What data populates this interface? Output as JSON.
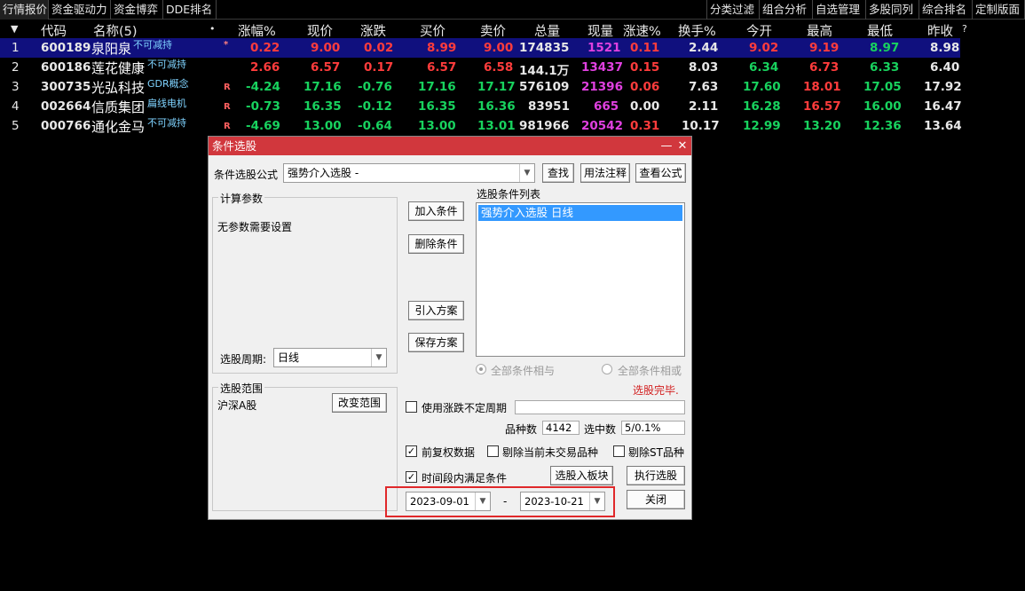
{
  "topbar": {
    "left_tabs": [
      "行情报价",
      "资金驱动力",
      "资金博弈",
      "DDE排名"
    ],
    "right_tabs": [
      "分类过滤",
      "组合分析",
      "自选管理",
      "多股同列",
      "综合排名",
      "定制版面"
    ]
  },
  "quote_table": {
    "headers": {
      "sort_icon": "▼",
      "code": "代码",
      "name": "名称(5)",
      "dot": "•",
      "pct": "涨幅%",
      "price": "现价",
      "change": "涨跌",
      "bid": "买价",
      "ask": "卖价",
      "volume": "总量",
      "cur_vol": "现量",
      "speed": "涨速%",
      "turnover": "换手%",
      "open": "今开",
      "high": "最高",
      "low": "最低",
      "prev_close": "昨收",
      "help": "?"
    },
    "rows": [
      {
        "num": "1",
        "code": "600189",
        "name": "泉阳泉",
        "tag": "不可减持",
        "flag": "*",
        "pct": "0.22",
        "price": "9.00",
        "change": "0.02",
        "bid": "8.99",
        "ask": "9.00",
        "volume": "174835",
        "cur_vol": "1521",
        "speed": "0.11",
        "turnover": "2.44",
        "open": "9.02",
        "high": "9.19",
        "low": "8.97",
        "prev_close": "8.98"
      },
      {
        "num": "2",
        "code": "600186",
        "name": "莲花健康",
        "tag": "不可减持",
        "flag": "",
        "pct": "2.66",
        "price": "6.57",
        "change": "0.17",
        "bid": "6.57",
        "ask": "6.58",
        "volume": "144.1万",
        "cur_vol": "13437",
        "speed": "0.15",
        "turnover": "8.03",
        "open": "6.34",
        "high": "6.73",
        "low": "6.33",
        "prev_close": "6.40"
      },
      {
        "num": "3",
        "code": "300735",
        "name": "光弘科技",
        "tag": "GDR概念",
        "flag": "R",
        "pct": "-4.24",
        "price": "17.16",
        "change": "-0.76",
        "bid": "17.16",
        "ask": "17.17",
        "volume": "576109",
        "cur_vol": "21396",
        "speed": "0.06",
        "turnover": "7.63",
        "open": "17.60",
        "high": "18.01",
        "low": "17.05",
        "prev_close": "17.92"
      },
      {
        "num": "4",
        "code": "002664",
        "name": "信质集团",
        "tag": "扁线电机",
        "flag": "R",
        "pct": "-0.73",
        "price": "16.35",
        "change": "-0.12",
        "bid": "16.35",
        "ask": "16.36",
        "volume": "83951",
        "cur_vol": "665",
        "speed": "0.00",
        "turnover": "2.11",
        "open": "16.28",
        "high": "16.57",
        "low": "16.00",
        "prev_close": "16.47"
      },
      {
        "num": "5",
        "code": "000766",
        "name": "通化金马",
        "tag": "不可减持",
        "flag": "R",
        "pct": "-4.69",
        "price": "13.00",
        "change": "-0.64",
        "bid": "13.00",
        "ask": "13.01",
        "volume": "981966",
        "cur_vol": "20542",
        "speed": "0.31",
        "turnover": "10.17",
        "open": "12.99",
        "high": "13.20",
        "low": "12.36",
        "prev_close": "13.64"
      }
    ]
  },
  "dialog": {
    "title": "条件选股",
    "minimize": "—",
    "close": "✕",
    "formula_label": "条件选股公式",
    "formula_value": "强势介入选股 -",
    "find_button": "查找",
    "usage_button": "用法注释",
    "view_formula_button": "查看公式",
    "params_group": "计算参数",
    "params_text": "无参数需要设置",
    "period_label": "选股周期:",
    "period_value": "日线",
    "add_condition": "加入条件",
    "delete_condition": "删除条件",
    "import_plan": "引入方案",
    "save_plan": "保存方案",
    "condition_list_label": "选股条件列表",
    "condition_items": [
      "强势介入选股  日线"
    ],
    "all_and": "全部条件相与",
    "all_or": "全部条件相或",
    "status_text": "选股完毕.",
    "range_group": "选股范围",
    "range_value": "沪深A股",
    "change_range": "改变范围",
    "use_irregular_period": "使用涨跌不定周期",
    "stock_count_label": "品种数",
    "stock_count_value": "4142",
    "selected_label": "选中数",
    "selected_value": "5/0.1%",
    "pre_adjust": "前复权数据",
    "exclude_no_trade": "剔除当前未交易品种",
    "exclude_st": "剔除ST品种",
    "period_satisfy": "时间段内满足条件",
    "to_block_button": "选股入板块",
    "execute_button": "执行选股",
    "start_date": "2023-09-01",
    "date_sep": "-",
    "end_date": "2023-10-21",
    "close_button": "关闭"
  }
}
